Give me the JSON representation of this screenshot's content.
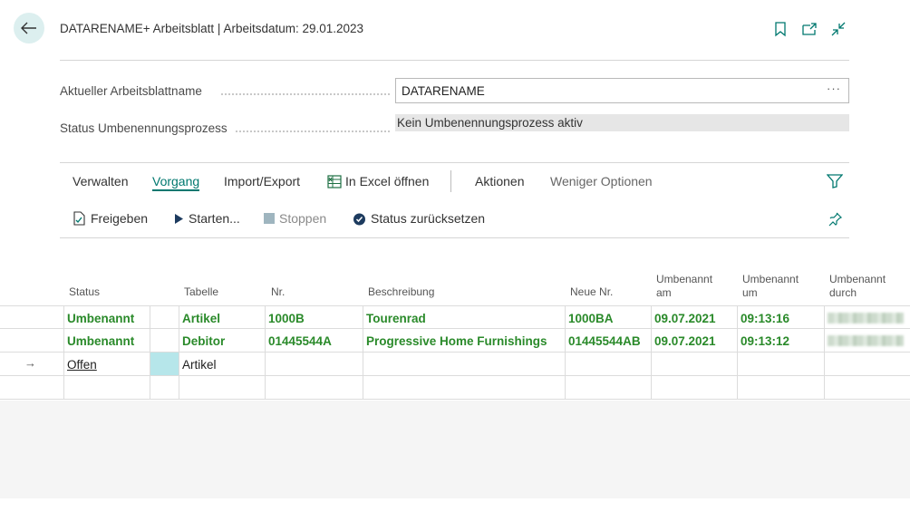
{
  "header": {
    "title": "DATARENAME+ Arbeitsblatt | Arbeitsdatum: 29.01.2023",
    "icons": [
      "bookmark-icon",
      "open-new-window-icon",
      "collapse-icon"
    ]
  },
  "fields": {
    "worksheet_name_label": "Aktueller Arbeitsblattname",
    "worksheet_name_value": "DATARENAME",
    "worksheet_name_more": "···",
    "status_label": "Status Umbenennungsprozess",
    "status_value": "Kein Umbenennungsprozess aktiv"
  },
  "menu": {
    "items": [
      "Verwalten",
      "Vorgang",
      "Import/Export",
      "In Excel öffnen",
      "Aktionen",
      "Weniger Optionen"
    ],
    "active": "Vorgang"
  },
  "actions": {
    "release": "Freigeben",
    "start": "Starten...",
    "stop": "Stoppen",
    "reset": "Status zurücksetzen"
  },
  "colors": {
    "accent": "#00786f",
    "green_text": "#2a8a2a",
    "focus_cell": "#b6e6ea"
  },
  "table": {
    "columns": {
      "status": "Status",
      "tabelle": "Tabelle",
      "nr": "Nr.",
      "beschreibung": "Beschreibung",
      "neue_nr": "Neue Nr.",
      "umbenannt_am_1": "Umbenannt",
      "umbenannt_am_2": "am",
      "umbenannt_um_1": "Umbenannt",
      "umbenannt_um_2": "um",
      "umbenannt_durch_1": "Umbenannt",
      "umbenannt_durch_2": "durch"
    },
    "rows": [
      {
        "status": "Umbenannt",
        "tabelle": "Artikel",
        "nr": "1000B",
        "beschreibung": "Tourenrad",
        "neue_nr": "1000BA",
        "am": "09.07.2021",
        "um": "09:13:16"
      },
      {
        "status": "Umbenannt",
        "tabelle": "Debitor",
        "nr": "01445544A",
        "beschreibung": "Progressive Home Furnishings",
        "neue_nr": "01445544AB",
        "am": "09.07.2021",
        "um": "09:13:12"
      },
      {
        "status": "Offen",
        "tabelle": "Artikel",
        "nr": "",
        "beschreibung": "",
        "neue_nr": "",
        "am": "",
        "um": ""
      }
    ],
    "current_row_marker": "→"
  }
}
